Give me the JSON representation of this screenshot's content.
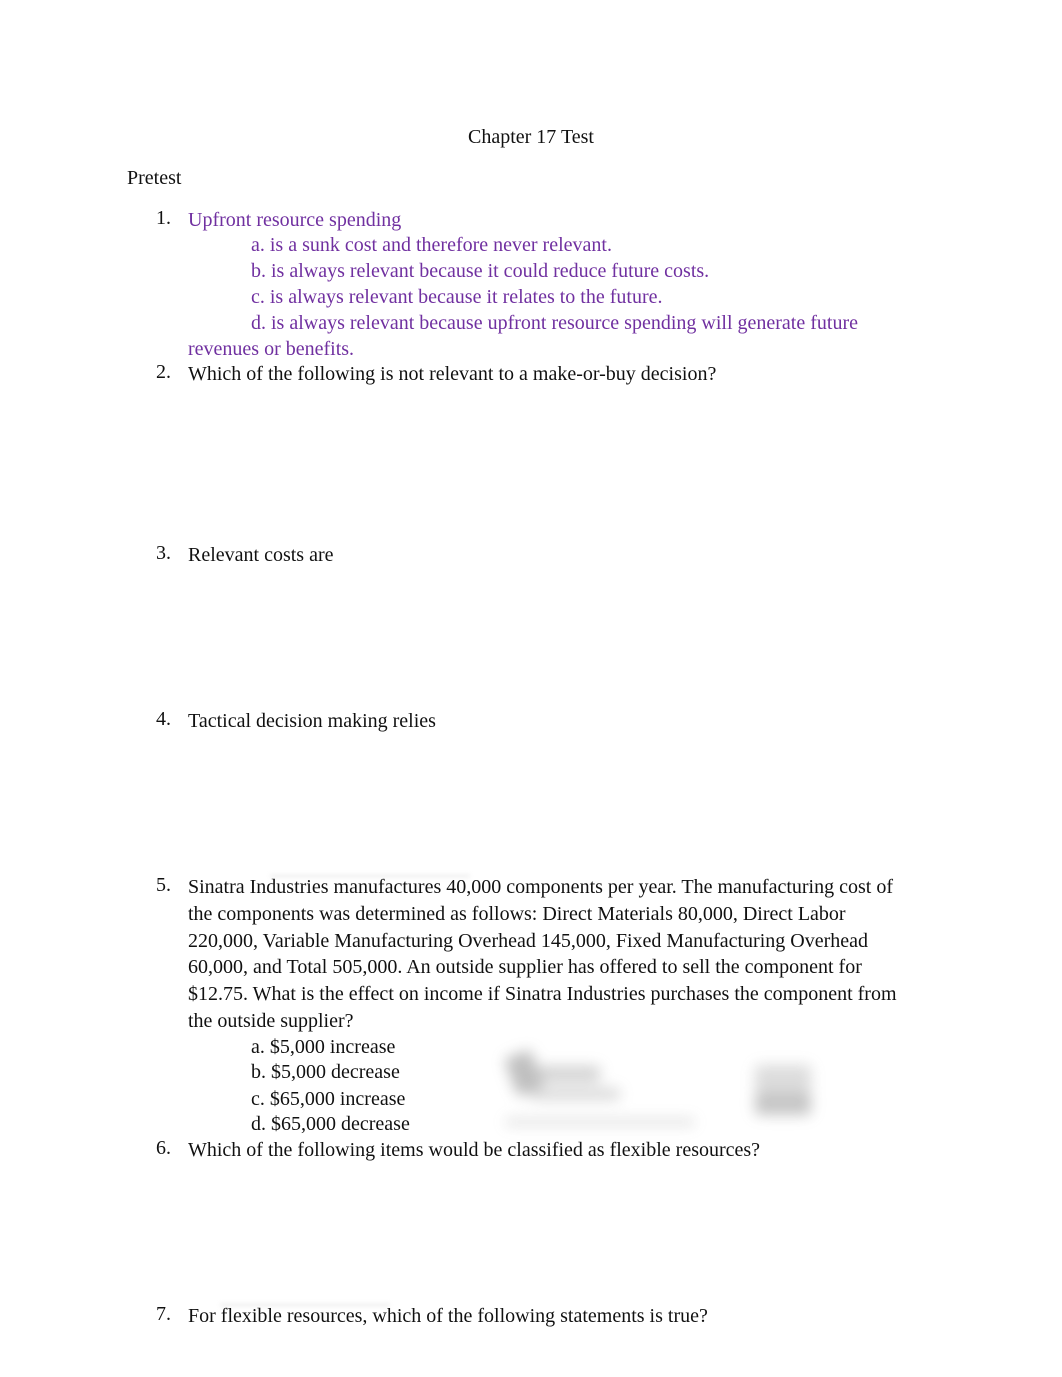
{
  "document": {
    "title": "Chapter 17 Test",
    "section": "Pretest",
    "accent_color": "#7030a0",
    "questions": [
      {
        "number": "1.",
        "text": "Upfront resource spending",
        "options": [
          "a. is a sunk cost and therefore never relevant.",
          "b. is always relevant because it could reduce future costs.",
          "c. is always relevant because it relates to the future.",
          "d. is always relevant because upfront resource spending will generate future"
        ],
        "continuation": "revenues or benefits."
      },
      {
        "number": "2.",
        "text": "Which of the following is not relevant to a make-or-buy decision?"
      },
      {
        "number": "3.",
        "text": "Relevant costs are"
      },
      {
        "number": "4.",
        "text": "Tactical decision making relies"
      },
      {
        "number": "5.",
        "text": "Sinatra Industries manufactures 40,000 components per year. The manufacturing cost of the components was determined as follows: Direct Materials 80,000, Direct Labor 220,000, Variable Manufacturing Overhead 145,000, Fixed Manufacturing Overhead 60,000, and Total 505,000. An outside supplier has offered to sell the component for $12.75. What is the effect on income if Sinatra Industries purchases the component from the outside supplier?",
        "lines": [
          "Sinatra Industries manufactures 40,000 components per year. The manufacturing cost of",
          "the components was determined as follows: Direct Materials 80,000, Direct Labor",
          "220,000, Variable Manufacturing Overhead 145,000, Fixed Manufacturing Overhead",
          "60,000, and Total 505,000. An outside supplier has offered to sell the component for",
          "$12.75. What is the effect on income if Sinatra Industries purchases the component from",
          "the outside supplier?"
        ],
        "options": [
          "a. $5,000 increase",
          "b. $5,000 decrease",
          "c. $65,000 increase",
          "d. $65,000 decrease"
        ]
      },
      {
        "number": "6.",
        "text": "Which of the following items would be classified as flexible resources?"
      },
      {
        "number": "7.",
        "text": "For flexible resources, which of the following statements is true?"
      }
    ]
  }
}
